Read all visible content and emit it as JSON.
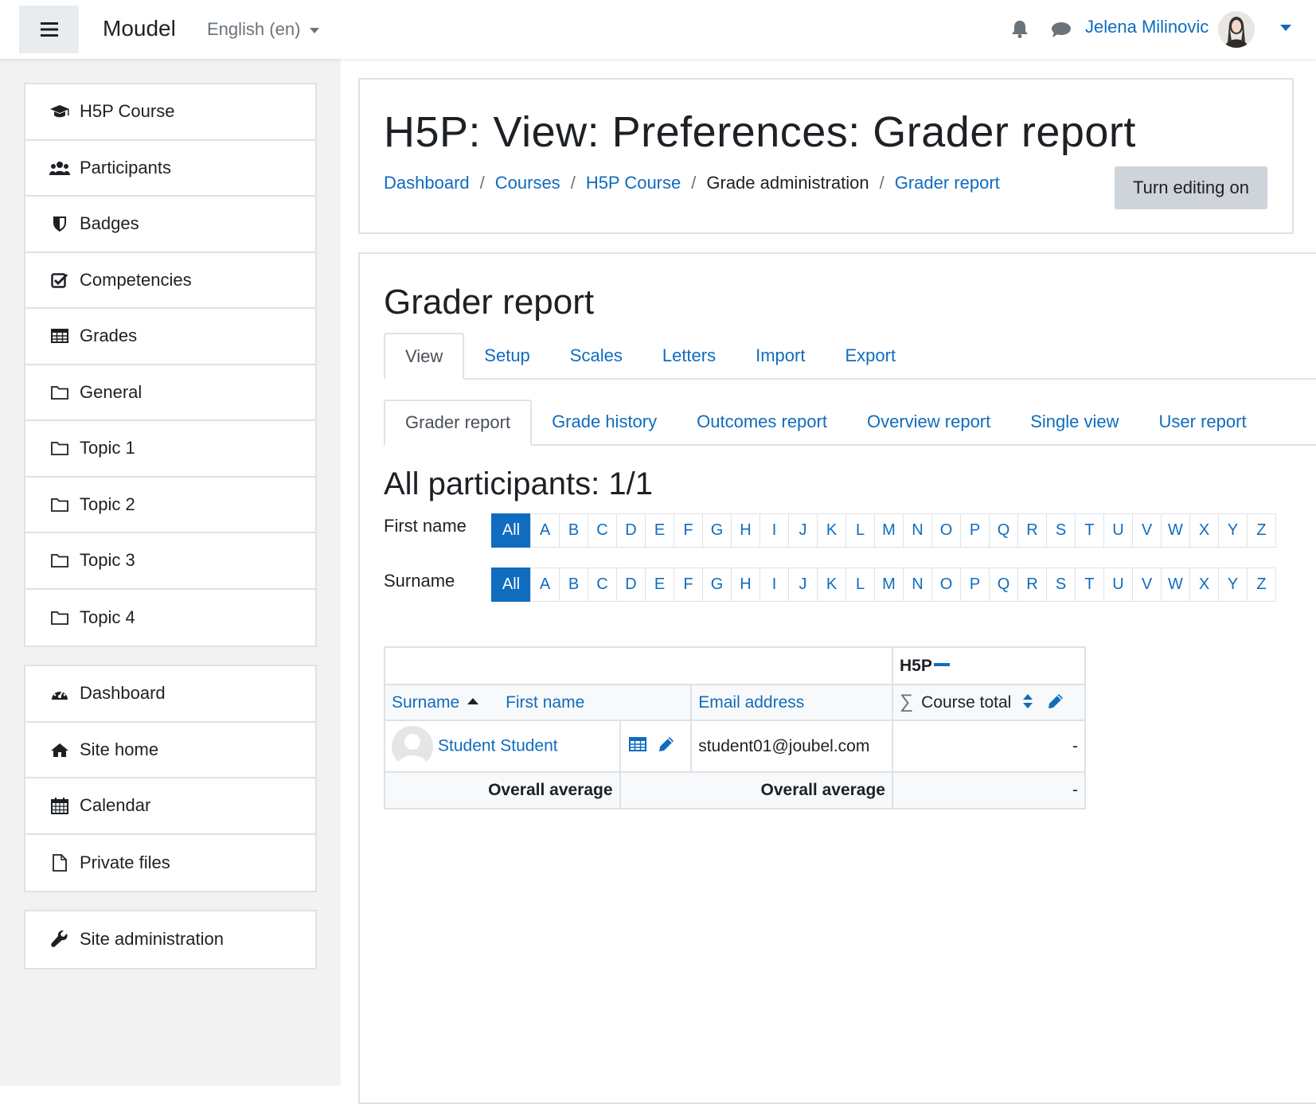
{
  "navbar": {
    "brand": "Moudel",
    "language": "English (en)",
    "username": "Jelena Milinovic"
  },
  "drawer": {
    "group1": [
      {
        "label": "H5P Course",
        "icon": "graduation-cap-icon"
      },
      {
        "label": "Participants",
        "icon": "users-icon"
      },
      {
        "label": "Badges",
        "icon": "shield-icon"
      },
      {
        "label": "Competencies",
        "icon": "check-square-icon"
      },
      {
        "label": "Grades",
        "icon": "table-icon"
      },
      {
        "label": "General",
        "icon": "folder-icon"
      },
      {
        "label": "Topic 1",
        "icon": "folder-icon"
      },
      {
        "label": "Topic 2",
        "icon": "folder-icon"
      },
      {
        "label": "Topic 3",
        "icon": "folder-icon"
      },
      {
        "label": "Topic 4",
        "icon": "folder-icon"
      }
    ],
    "group2": [
      {
        "label": "Dashboard",
        "icon": "dashboard-icon"
      },
      {
        "label": "Site home",
        "icon": "home-icon"
      },
      {
        "label": "Calendar",
        "icon": "calendar-icon"
      },
      {
        "label": "Private files",
        "icon": "file-icon"
      }
    ],
    "group3": [
      {
        "label": "Site administration",
        "icon": "wrench-icon"
      }
    ]
  },
  "header": {
    "title": "H5P: View: Preferences: Grader report",
    "breadcrumbs": [
      "Dashboard",
      "Courses",
      "H5P Course",
      "Grade administration",
      "Grader report"
    ],
    "edit_button": "Turn editing on"
  },
  "report": {
    "heading": "Grader report",
    "tabs": [
      "View",
      "Setup",
      "Scales",
      "Letters",
      "Import",
      "Export"
    ],
    "subtabs": [
      "Grader report",
      "Grade history",
      "Outcomes report",
      "Overview report",
      "Single view",
      "User report"
    ],
    "participants_heading": "All participants: 1/1",
    "firstname_label": "First name",
    "surname_label": "Surname",
    "all_label": "All",
    "letters": [
      "A",
      "B",
      "C",
      "D",
      "E",
      "F",
      "G",
      "H",
      "I",
      "J",
      "K",
      "L",
      "M",
      "N",
      "O",
      "P",
      "Q",
      "R",
      "S",
      "T",
      "U",
      "V",
      "W",
      "X",
      "Y",
      "Z"
    ]
  },
  "table": {
    "category": "H5P",
    "col_surname": "Surname",
    "col_firstname": "First name",
    "col_email": "Email address",
    "col_total": "Course total",
    "student_name": "Student Student",
    "student_email": "student01@joubel.com",
    "student_total": "-",
    "overall_label": "Overall average",
    "overall_total": "-"
  },
  "colors": {
    "link": "#0f6cbf",
    "drawer_bg": "#f2f2f2",
    "border": "#dee2e6"
  }
}
